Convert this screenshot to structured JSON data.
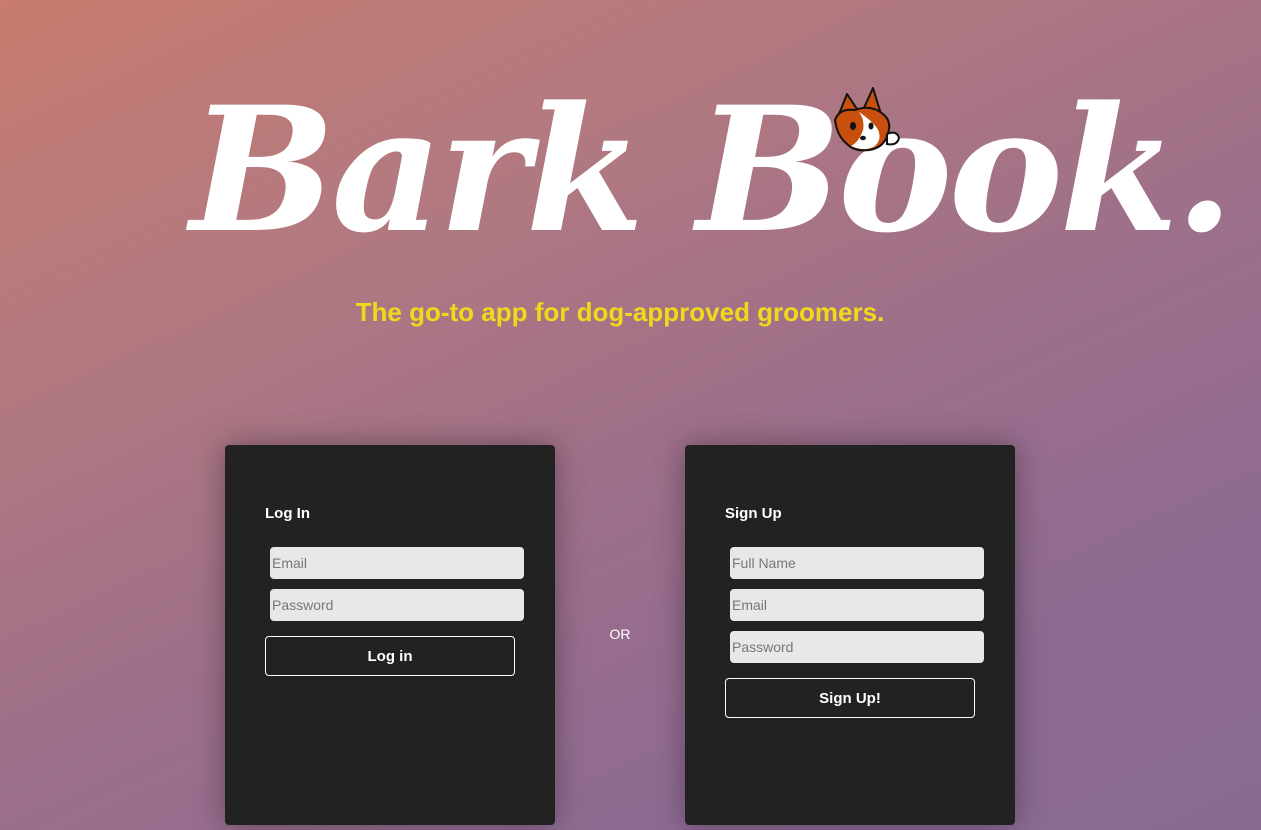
{
  "header": {
    "logo_text": "Bark Book.",
    "tagline": "The go-to app for dog-approved groomers."
  },
  "login": {
    "title": "Log In",
    "email_placeholder": "Email",
    "password_placeholder": "Password",
    "button_label": "Log in"
  },
  "separator": {
    "label": "OR"
  },
  "signup": {
    "title": "Sign Up",
    "name_placeholder": "Full Name",
    "email_placeholder": "Email",
    "password_placeholder": "Password",
    "button_label": "Sign Up!"
  },
  "colors": {
    "tagline": "#f2d81a",
    "card_background": "#222222",
    "input_background": "#e8e8e8"
  },
  "icons": {
    "logo_mascot": "corgi-dog-icon"
  }
}
